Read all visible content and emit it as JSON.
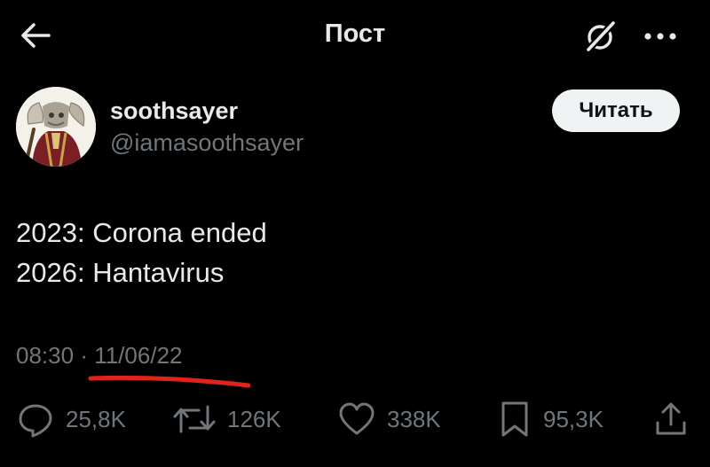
{
  "header": {
    "title": "Пост",
    "back_icon": "arrow-left-icon",
    "grok_icon": "grok-icon",
    "more_icon": "more-horizontal-icon"
  },
  "author": {
    "display_name": "soothsayer",
    "handle": "@iamasoothsayer",
    "follow_label": "Читать"
  },
  "post": {
    "lines": [
      "2023: Corona ended",
      "2026: Hantavirus"
    ],
    "time": "08:30",
    "separator": "·",
    "date": "11/06/22"
  },
  "actions": {
    "replies": "25,8K",
    "reposts": "126K",
    "likes": "338K",
    "bookmarks": "95,3K"
  },
  "colors": {
    "background": "#000000",
    "text": "#e7e9ea",
    "muted": "#71767b",
    "button": "#eff3f4",
    "annotation": "#e0241b"
  }
}
